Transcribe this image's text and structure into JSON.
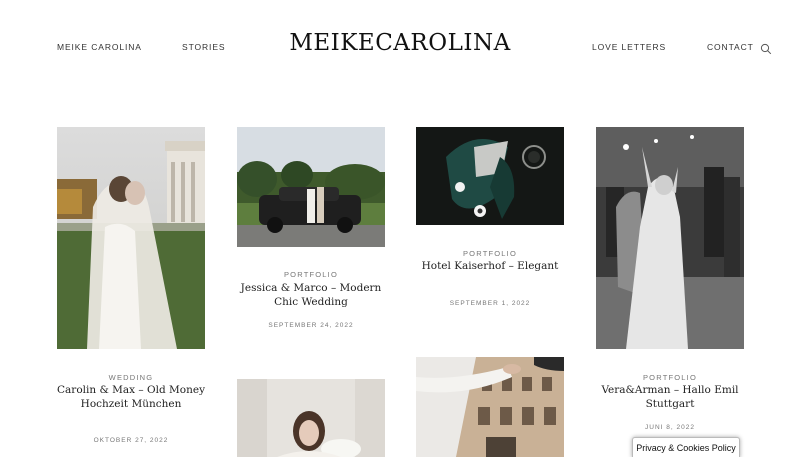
{
  "header": {
    "logo": "MEIKECAROLINA",
    "nav_left": [
      "MEIKE CAROLINA",
      "STORIES"
    ],
    "nav_right": [
      "LOVE LETTERS",
      "CONTACT"
    ],
    "search_icon": "search-icon"
  },
  "posts": [
    {
      "category": "WEDDING",
      "title": "Carolin & Max – Old Money Hochzeit München",
      "date": "OKTOBER 27, 2022"
    },
    {
      "category": "PORTFOLIO",
      "title": "Jessica & Marco – Modern Chic Wedding",
      "date": "SEPTEMBER 24, 2022"
    },
    {
      "category": "PORTFOLIO",
      "title": "Hotel Kaiserhof – Elegant",
      "date": "SEPTEMBER 1, 2022"
    },
    {
      "category": "PORTFOLIO",
      "title": "Vera&Arman – Hallo Emil Stuttgart",
      "date": "JUNI 8, 2022"
    }
  ],
  "privacy_badge": "Privacy & Cookies Policy"
}
